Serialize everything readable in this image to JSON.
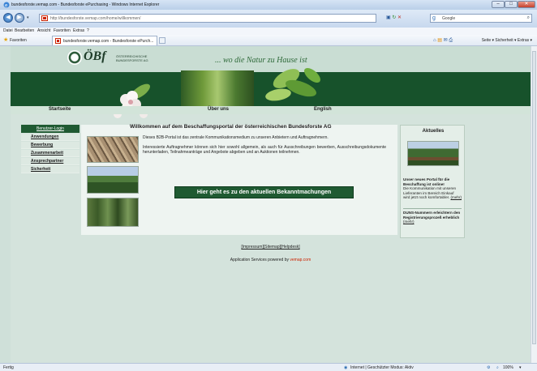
{
  "window": {
    "title": "bundesforste.vemap.com - Bundesforste ePurchasing - Windows Internet Explorer"
  },
  "addressbar": {
    "url": "http://bundesforste.vemap.com/home/willkommen/",
    "search_placeholder": "Google"
  },
  "menubar": {
    "items": [
      "Datei",
      "Bearbeiten",
      "Ansicht",
      "Favoriten",
      "Extras",
      "?"
    ]
  },
  "favbar": {
    "favorites_label": "Favoriten",
    "tab_title": "bundesforste.vemap.com - Bundesforste ePurch...",
    "commands": "Seite ▾   Sicherheit ▾   Extras ▾"
  },
  "header": {
    "logo_text": "ÖBf",
    "logo_subtext": "ÖSTERREICHISCHE BUNDESFORSTE AG",
    "slogan": "... wo die Natur zu Hause ist"
  },
  "nav": {
    "items": [
      "Startseite",
      "Über uns",
      "English"
    ]
  },
  "leftnav": {
    "login": "Benutzer-Login",
    "items": [
      "Anwendungen",
      "Bewerbung",
      "Zusammenarbeit",
      "Ansprechpartner",
      "Sicherheit"
    ]
  },
  "main": {
    "title": "Willkommen auf dem Beschaffungsportal der österreichischen Bundesforste AG",
    "intro": "Dieses B2B-Portal ist das zentrale Kommunikationsmedium zu unseren Anbietern und Auftragnehmern.",
    "description": "Interessierte Auftragnehmer können sich hier sowohl allgemein, als auch für Ausschreibungen bewerben, Ausschreibungsdokumente herunterladen, Teilnahmeanträge und Angebote abgeben und an Auktionen teilnehmen.",
    "cta": "Hier geht es zu den aktuellen Bekanntmachungen"
  },
  "aktuelles": {
    "title": "Aktuelles",
    "news1_title": "Unser neues Portal für die Beschaffung ist online!",
    "news1_body": "Die Kommunikation mit unseren Lieferanten im Bereich Einkauf wird jetzt noch komfortabler.",
    "news1_more": "(mehr)",
    "news2_title": "DUNS-Nummern erleichtern den Registrierungsprozeß erheblich",
    "news2_more": "(mehr)"
  },
  "footer": {
    "impressum": "[Impressum]",
    "sitemap": "[Sitemap]",
    "helpdesk": "[Helpdesk]",
    "powered_prefix": "Application Services powered by",
    "powered_brand": "vemap.com"
  },
  "statusbar": {
    "left": "Fertig",
    "zone": "Internet | Geschützter Modus: Aktiv",
    "zoom": "100%"
  }
}
